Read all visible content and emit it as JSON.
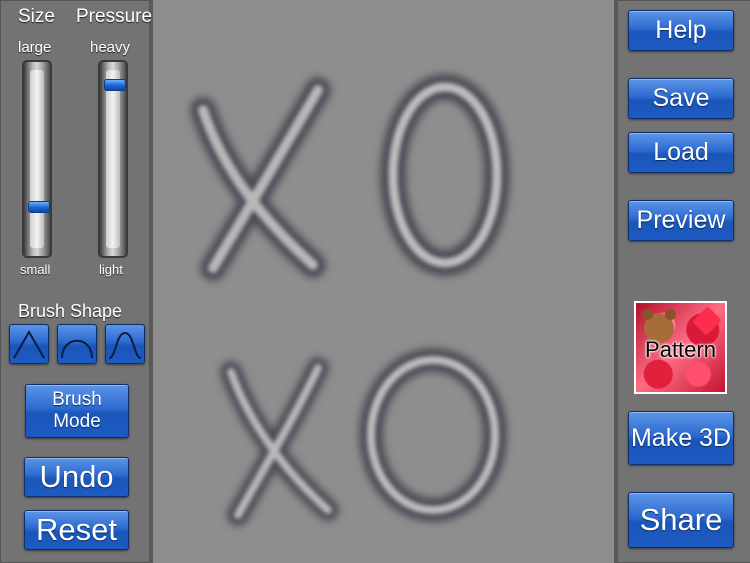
{
  "left_panel": {
    "size_slider": {
      "title": "Size",
      "top_label": "large",
      "bottom_label": "small",
      "level": 0.22
    },
    "pressure_slider": {
      "title": "Pressure",
      "top_label": "heavy",
      "bottom_label": "light",
      "level": 0.93
    },
    "brush_shape_title": "Brush Shape",
    "brush_shapes": [
      "triangle-shape-icon",
      "round-shape-icon",
      "bell-shape-icon"
    ],
    "brush_mode_label": [
      "Brush",
      "Mode"
    ],
    "undo_label": "Undo",
    "reset_label": "Reset"
  },
  "right_panel": {
    "help_label": "Help",
    "save_label": "Save",
    "load_label": "Load",
    "preview_label": "Preview",
    "pattern_label": "Pattern",
    "make3d_label": "Make 3D",
    "share_label": "Share"
  },
  "canvas": {
    "drawing_strokes": [
      "X",
      "O",
      "X",
      "O"
    ]
  },
  "colors": {
    "button_blue": "#2d6ad0",
    "panel_gray": "#737373",
    "canvas_gray": "#8e8e8e"
  }
}
